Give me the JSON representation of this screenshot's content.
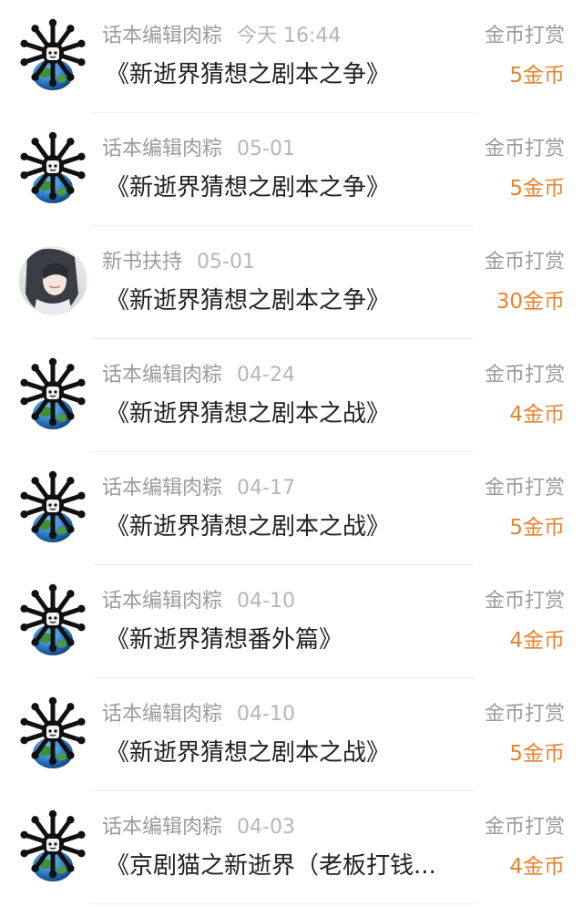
{
  "records": [
    {
      "sender": "话本编辑肉粽",
      "date": "今天 16:44",
      "title": "《新逝界猜想之剧本之争》",
      "reward_type": "金币打赏",
      "amount": "5金币",
      "avatar": "editor-avatar"
    },
    {
      "sender": "话本编辑肉粽",
      "date": "05-01",
      "title": "《新逝界猜想之剧本之争》",
      "reward_type": "金币打赏",
      "amount": "5金币",
      "avatar": "editor-avatar"
    },
    {
      "sender": "新书扶持",
      "date": "05-01",
      "title": "《新逝界猜想之剧本之争》",
      "reward_type": "金币打赏",
      "amount": "30金币",
      "avatar": "support-avatar"
    },
    {
      "sender": "话本编辑肉粽",
      "date": "04-24",
      "title": "《新逝界猜想之剧本之战》",
      "reward_type": "金币打赏",
      "amount": "4金币",
      "avatar": "editor-avatar"
    },
    {
      "sender": "话本编辑肉粽",
      "date": "04-17",
      "title": "《新逝界猜想之剧本之战》",
      "reward_type": "金币打赏",
      "amount": "5金币",
      "avatar": "editor-avatar"
    },
    {
      "sender": "话本编辑肉粽",
      "date": "04-10",
      "title": "《新逝界猜想番外篇》",
      "reward_type": "金币打赏",
      "amount": "4金币",
      "avatar": "editor-avatar"
    },
    {
      "sender": "话本编辑肉粽",
      "date": "04-10",
      "title": "《新逝界猜想之剧本之战》",
      "reward_type": "金币打赏",
      "amount": "5金币",
      "avatar": "editor-avatar"
    },
    {
      "sender": "话本编辑肉粽",
      "date": "04-03",
      "title": "《京剧猫之新逝界（老板打钱...",
      "reward_type": "金币打赏",
      "amount": "4金币",
      "avatar": "editor-avatar"
    }
  ],
  "colors": {
    "meta_text": "#9b9b9b",
    "title_text": "#222222",
    "amount_text": "#e8822e",
    "divider": "#ededed"
  }
}
